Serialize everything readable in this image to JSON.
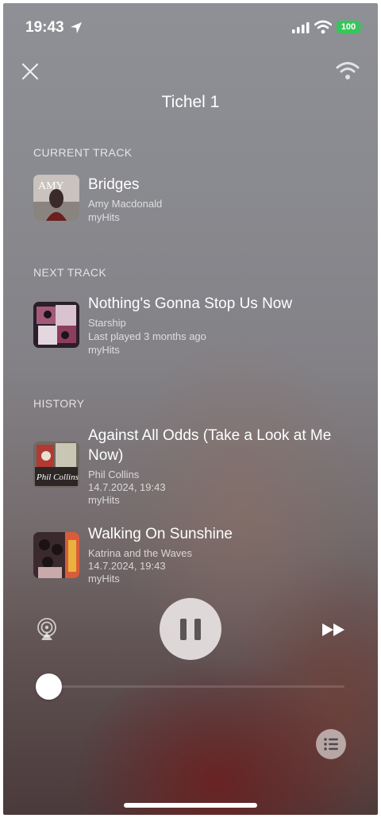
{
  "status_bar": {
    "time": "19:43",
    "battery": "100"
  },
  "header": {
    "title": "Tichel 1"
  },
  "sections": {
    "current": "CURRENT TRACK",
    "next": "NEXT TRACK",
    "history": "HISTORY"
  },
  "current_track": {
    "title": "Bridges",
    "artist": "Amy Macdonald",
    "station": "myHits",
    "art_text": "AMY"
  },
  "next_track": {
    "title": "Nothing's Gonna Stop Us Now",
    "artist": "Starship",
    "last_played": "Last played 3 months ago",
    "station": "myHits"
  },
  "history": [
    {
      "title": "Against All Odds (Take a Look at Me Now)",
      "artist": "Phil Collins",
      "played": "14.7.2024, 19:43",
      "station": "myHits",
      "art_text": "Phil Collins"
    },
    {
      "title": "Walking On Sunshine",
      "artist": "Katrina and the Waves",
      "played": "14.7.2024, 19:43",
      "station": "myHits"
    }
  ],
  "player": {
    "progress": 0.0
  },
  "colors": {
    "battery": "#34c759",
    "pause_button_bg": "#ebe6e6"
  },
  "icons": [
    "location-arrow-icon",
    "signal-icon",
    "wifi-icon",
    "battery-icon",
    "close-icon",
    "wifi-icon",
    "airplay-icon",
    "pause-icon",
    "fast-forward-icon",
    "queue-list-icon"
  ]
}
